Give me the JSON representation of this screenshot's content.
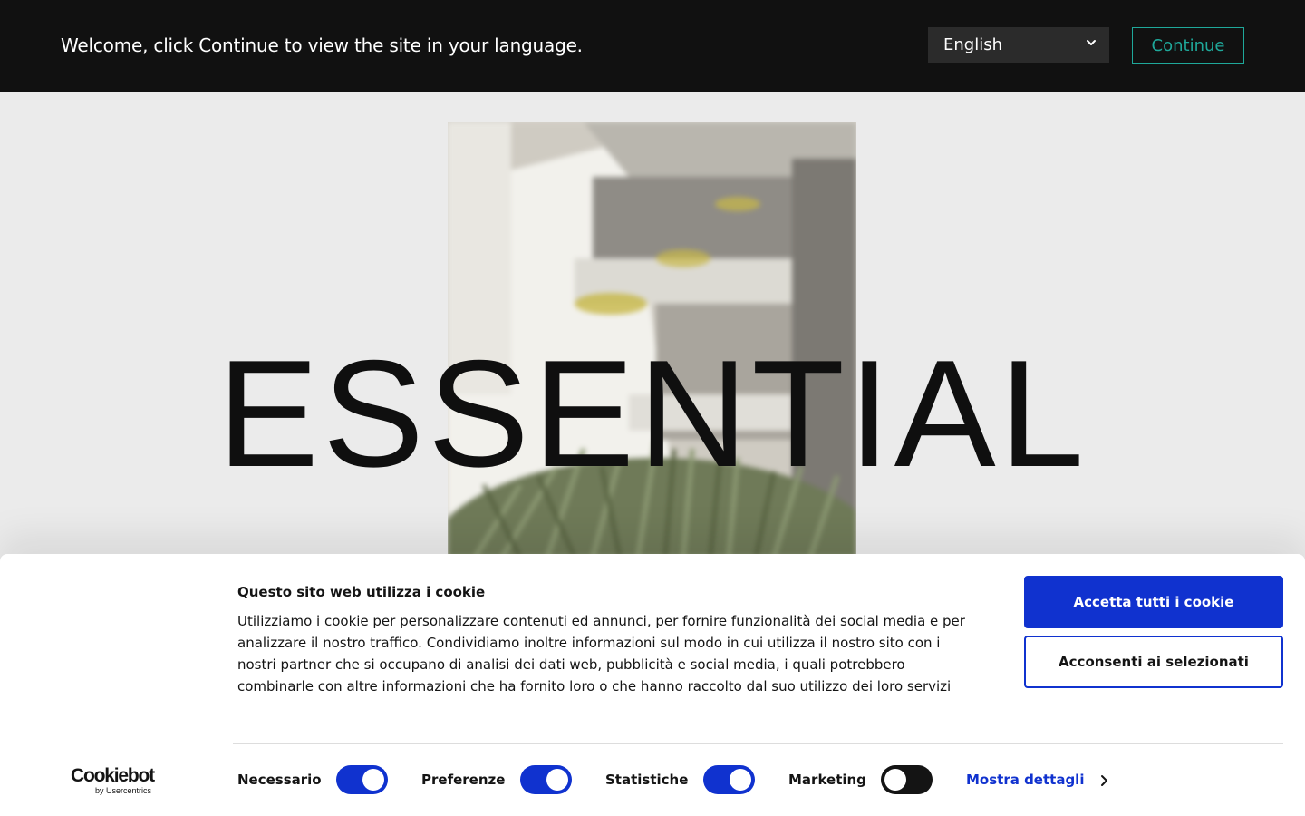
{
  "language_banner": {
    "message": "Welcome, click Continue to view the site in your language.",
    "selected_language": "English",
    "continue_label": "Continue"
  },
  "hero": {
    "title": "ESSENTIAL"
  },
  "cookie_banner": {
    "title": "Questo sito web utilizza i cookie",
    "body": "Utilizziamo i cookie per personalizzare contenuti ed annunci, per fornire funzionalità dei social media e per analizzare il nostro traffico. Condividiamo inoltre informazioni sul modo in cui utilizza il nostro sito con i nostri partner che si occupano di analisi dei dati web, pubblicità e social media, i quali potrebbero combinarle con altre informazioni che ha fornito loro o che hanno raccolto dal suo utilizzo dei loro servizi",
    "accept_all_label": "Accetta tutti i cookie",
    "allow_selected_label": "Acconsenti ai selezionati",
    "brand_main": "Cookiebot",
    "brand_sub": "by Usercentrics",
    "toggles": [
      {
        "label": "Necessario",
        "on": true
      },
      {
        "label": "Preferenze",
        "on": true
      },
      {
        "label": "Statistiche",
        "on": true
      },
      {
        "label": "Marketing",
        "on": false
      }
    ],
    "details_label": "Mostra dettagli"
  },
  "colors": {
    "accent_blue": "#1032cf",
    "continue_teal": "#1fa89a",
    "banner_bg": "#111111",
    "page_bg": "#ebebeb"
  },
  "icons": [
    "chevron-down-icon",
    "chevron-right-icon",
    "cookiebot-logo"
  ]
}
